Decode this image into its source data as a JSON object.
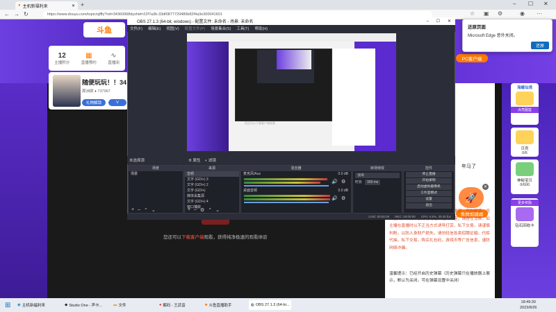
{
  "browser": {
    "tab_title": "主机新福利来",
    "url": "https://www.douyu.com/topic/sjfffy?rid=34360968dyshid=22f7a3b-33df0877729480b82f4a3e300041601"
  },
  "page": {
    "logo_text": "斗鱼",
    "stats": [
      {
        "value": "12",
        "label": "主播积分"
      },
      {
        "value": "",
        "label": "直播预约"
      },
      {
        "value": "",
        "label": "直播间"
      }
    ],
    "anchor_title": "随便玩玩！！34",
    "anchor_name": "周洲欲",
    "anchor_id": "737967",
    "btn_gift": "礼物解锁",
    "btn_vip": "V",
    "download_prompt_prefix": "您还可以",
    "download_prompt_link": "下载客户端",
    "download_prompt_suffix": "观看，获得纯净极速的观看体验",
    "pc_client": "PC客户端",
    "speed_button": "免费加速器",
    "year_text": "年马了",
    "right_text": "，第三方不规则的违法。单次当地建群流，否则解惑，否则色情。赌博诈骗等行为违法违规内容，请理性消费，如主播在直播时以不正当方式诱导打赏，私下交易，请谨慎判断，以防人身财产损失。请勿轻信各类招聘征婚，代练代抽，私下交易，购买礼包码，游戏币等广告信息，谨防网络诈骗。",
    "hint": "温馨提示：已经开启历史弹幕（历史弹幕只在播放器上展示，默认为关闭，可在弹幕设置中关闭）",
    "side_cards": [
      {
        "title": "海螺仙境",
        "label": "点亮图鉴"
      },
      {
        "title": "贝壳",
        "label": "0/6"
      },
      {
        "title": "神秘宝贝",
        "label": "0/600"
      },
      {
        "title": "更多奖励",
        "label": "钻石回收卡"
      }
    ]
  },
  "edge_popup": {
    "title": "还原页面",
    "message": "Microsoft Edge 意外关闭。",
    "button": "还原"
  },
  "obs": {
    "title": "OBS 27.1.3 (64-bit, windows) - 配置文件: 未命名 - 场景: 未命名",
    "menu": [
      "文件(F)",
      "编辑(E)",
      "视图(V)",
      "配置文件(P)",
      "场景集合(S)",
      "工具(T)",
      "帮助(H)"
    ],
    "preview_prompt": "您还可以下载客户端观看",
    "scene_bar": "未选择源",
    "scene_bar_tabs": [
      "属性",
      "滤镜"
    ],
    "docks": {
      "scenes": {
        "header": "场景",
        "items": [
          "场景"
        ]
      },
      "sources": {
        "header": "来源",
        "items": [
          "音频",
          "文字 (GDI+) 3",
          "文字 (GDI+) 2",
          "文字 (GDI+)",
          "媒体采集源",
          "文字 (GDI+) 4",
          "窗口捕获"
        ]
      },
      "mixer": {
        "header": "混音器",
        "tracks": [
          {
            "name": "麦克风/Aux",
            "db": "0.0 dB"
          },
          {
            "name": "桌面音频",
            "db": "0.0 dB"
          }
        ]
      },
      "transitions": {
        "header": "转场特效",
        "mode": "淡出",
        "duration_label": "时长",
        "duration_value": "300 ms"
      },
      "controls": {
        "header": "控件",
        "buttons": [
          "停止直播",
          "开始录制",
          "启动虚拟摄像机",
          "工作室模式",
          "设置",
          "退出"
        ]
      }
    },
    "status": [
      "LIVE: 00:00:00",
      "REC: 00:00:00",
      "CPU: 0.5%, 30.00 fps"
    ]
  },
  "taskbar": {
    "items": [
      "主机新福利来",
      "Studio One - 声卡...",
      "文件",
      "解码 - 王武音",
      "斗鱼直播助手",
      "OBS 27.1.3 (64-bi..."
    ],
    "time": "18:49:30",
    "date": "2023/8/26"
  }
}
